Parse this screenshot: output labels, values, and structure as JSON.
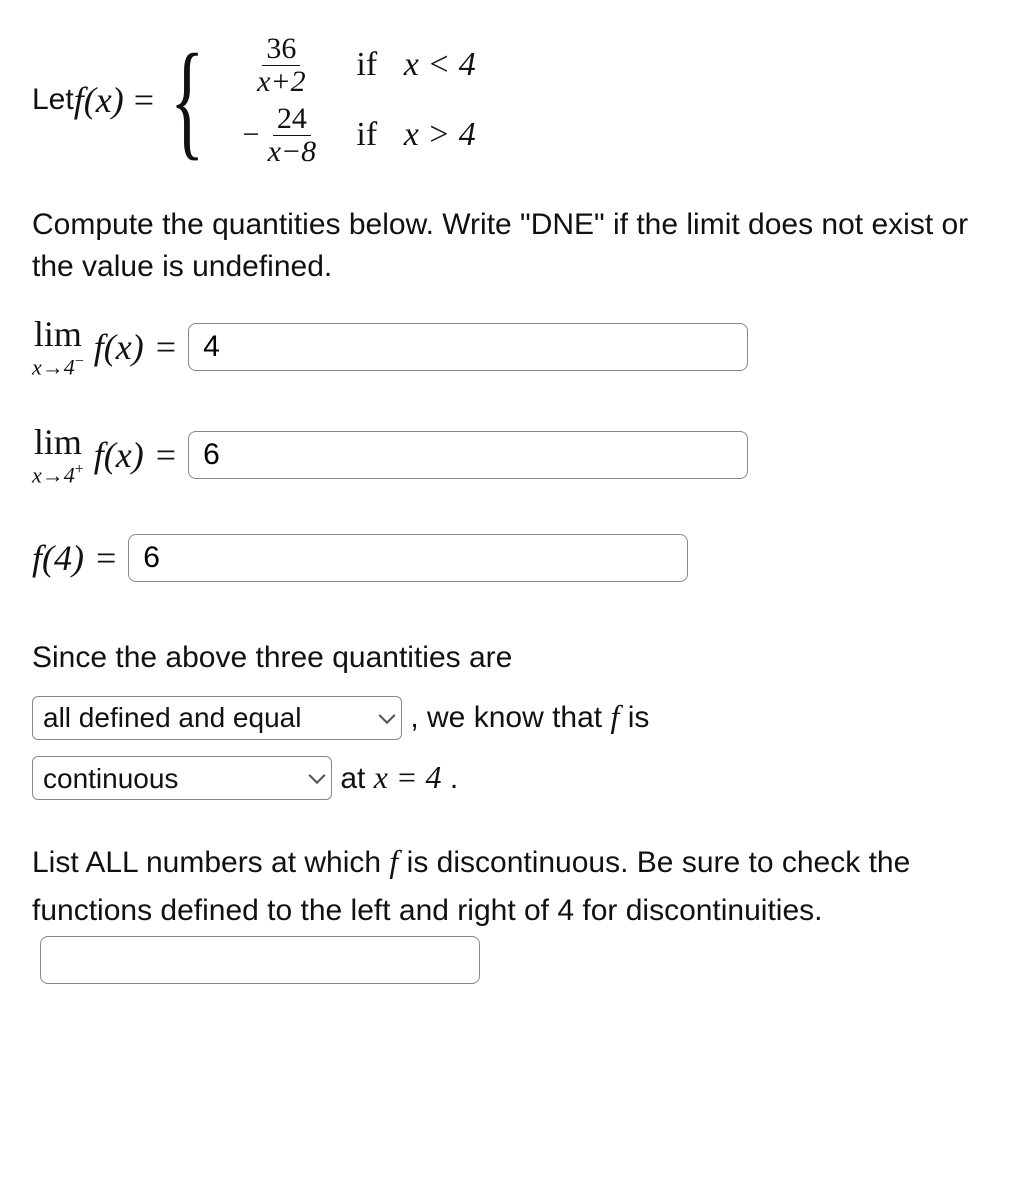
{
  "definition": {
    "let": "Let ",
    "fx": "f(x)",
    "eq": " = ",
    "piece1_num": "36",
    "piece1_den": "x+2",
    "piece1_cond_if": "if",
    "piece1_cond": "x < 4",
    "piece2_minus": "−",
    "piece2_num": "24",
    "piece2_den": "x−8",
    "piece2_cond_if": "if",
    "piece2_cond": "x > 4"
  },
  "instruction1": "Compute the quantities below. Write \"DNE\" if the limit does not exist or the value is undefined.",
  "q1": {
    "lim": "lim",
    "sub": "x→4",
    "sup": "−",
    "fx": "f(x)",
    "eq": " = ",
    "value": "4"
  },
  "q2": {
    "lim": "lim",
    "sub": "x→4",
    "sup": "+",
    "fx": "f(x)",
    "eq": " = ",
    "value": "6"
  },
  "q3": {
    "label": "f(4)",
    "eq": " = ",
    "value": "6"
  },
  "conclusion": {
    "t1": "Since the above three quantities are",
    "sel1": "all defined and equal",
    "t2": ", we know that ",
    "f": "f",
    "t3": " is",
    "sel2": "continuous",
    "t4": " at ",
    "xeq": "x = 4",
    "period": "."
  },
  "instruction2a": "List ALL numbers at which ",
  "instruction2f": "f",
  "instruction2b": " is discontinuous. Be sure to check the functions defined to the left and right of 4 for discontinuities.",
  "discontinuities_value": ""
}
